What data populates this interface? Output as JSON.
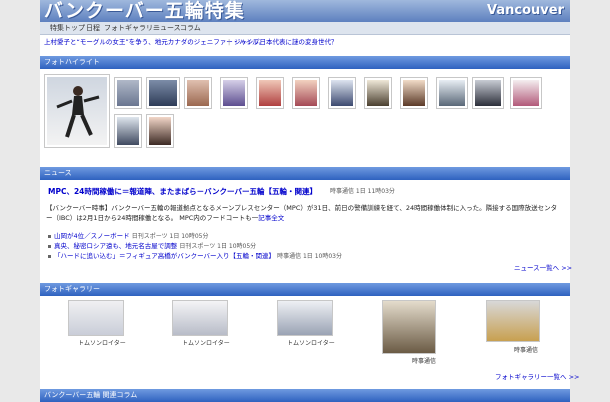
{
  "header": {
    "title": "バンクーバー五輪特集",
    "logo_text": "Vancouver"
  },
  "nav": {
    "items": [
      "特集トップ",
      "日程",
      "フォトギャラリー",
      "ニュース",
      "コラム"
    ]
  },
  "ticker": {
    "items": [
      "上村愛子と“モーグルの女王”を争う、地元カナダのジェニファー・ハイル。",
      "ジャンプ日本代表に謎の変身世代？"
    ]
  },
  "sections": {
    "photo_highlight": "フォトハイライト",
    "news": "ニュース",
    "gallery": "フォトギャラリー",
    "column": "バンクーバー五輪 関連コラム"
  },
  "news": {
    "headline": "MPC、24時間稼働に＝報道陣、またまばら－バンクーバー五輪",
    "headline_tag": "【五輪・関連】",
    "headline_date": "時事通信 1日 11時03分",
    "body": "【バンクーバー時事】バンクーバー五輪の報道拠点となるメーンプレスセンター（MPC）が31日、前日の警備訓練を経て、24時間稼働体制に入った。隣接する国際放送センター（IBC）は2月1日から24時間稼働となる。 MPC内のフードコートも一",
    "body_link": "記事全文",
    "list": [
      {
        "title": "山岡が4位／スノーボード",
        "date": "日刊スポーツ 1日 10時05分"
      },
      {
        "title": "真央、秘密ロシア遠も、地元名古屋で調整",
        "date": "日刊スポーツ 1日 10時05分"
      },
      {
        "title": "「ハードに追い込む」＝フィギュア高橋がバンクーバー入り【五輪・関連】",
        "date": "時事通信 1日 10時03分"
      }
    ],
    "more": "ニュース一覧へ >>"
  },
  "gallery": {
    "items": [
      {
        "caption": "トムソンロイター"
      },
      {
        "caption": "トムソンロイター"
      },
      {
        "caption": "トムソンロイター"
      },
      {
        "caption": "時事通信"
      },
      {
        "caption": "時事通信"
      }
    ],
    "more": "フォトギャラリー一覧へ >>"
  },
  "colors": {
    "bar_top": "#6f9ae0",
    "bar_bottom": "#2f62bf",
    "link": "#0000cc",
    "header": "#5d80bf"
  }
}
